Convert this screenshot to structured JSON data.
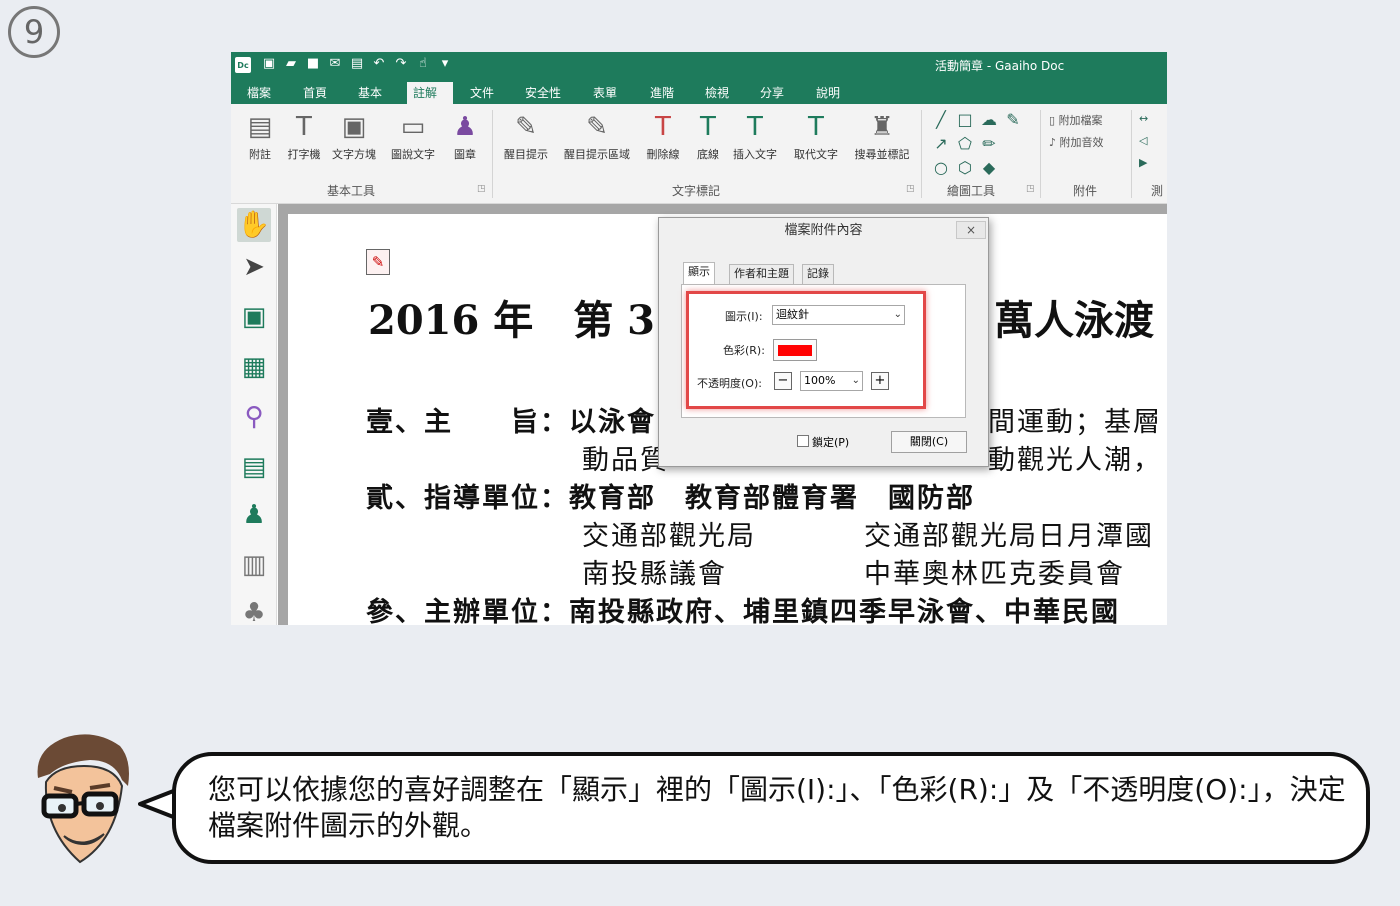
{
  "step": "9",
  "app": {
    "logo": "Dc",
    "window_title": "活動簡章 - Gaaiho Doc",
    "tabs": [
      "檔案",
      "首頁",
      "基本",
      "註解",
      "文件",
      "安全性",
      "表單",
      "進階",
      "檢視",
      "分享",
      "說明"
    ],
    "active_tab": "註解"
  },
  "ribbon": {
    "basic_tools": [
      "附註",
      "打字機",
      "文字方塊",
      "圖說文字",
      "圖章"
    ],
    "basic_tools_group": "基本工具",
    "text_markup": [
      "醒目提示",
      "醒目提示區域",
      "刪除線",
      "底線",
      "插入文字",
      "取代文字",
      "搜尋並標記"
    ],
    "text_markup_group": "文字標記",
    "drawing_group": "繪圖工具",
    "attachments": [
      "附加檔案",
      "附加音效"
    ],
    "attachments_group": "附件",
    "measure_group": "測"
  },
  "document": {
    "title_left": "2016 年　第 3",
    "title_right": "萬人泳渡",
    "line1_left": "壹、主　　旨：以泳會",
    "line1_right": "間運動；基層",
    "line2_left": "動品質",
    "line2_right": "動觀光人潮，",
    "line3": "貳、指導單位：教育部　教育部體育署　國防部",
    "line4_left": "交通部觀光局",
    "line4_right": "交通部觀光局日月潭國",
    "line5_left": "南投縣議會",
    "line5_right": "中華奧林匹克委員會",
    "line6": "參、主辦單位：南投縣政府、埔里鎮四季早泳會、中華民國"
  },
  "dialog": {
    "title": "檔案附件內容",
    "close_glyph": "×",
    "tabs": [
      "顯示",
      "作者和主題",
      "記錄"
    ],
    "icon_label": "圖示(I):",
    "icon_value": "迴紋針",
    "color_label": "色彩(R):",
    "color_value": "#ff0000",
    "opacity_label": "不透明度(O):",
    "opacity_value": "100%",
    "lock_label": "鎖定(P)",
    "close_label": "關閉(C)"
  },
  "bubble_text": "您可以依據您的喜好調整在「顯示」裡的「圖示(I):」、「色彩(R):」及「不透明度(O):」，決定檔案附件圖示的外觀。"
}
